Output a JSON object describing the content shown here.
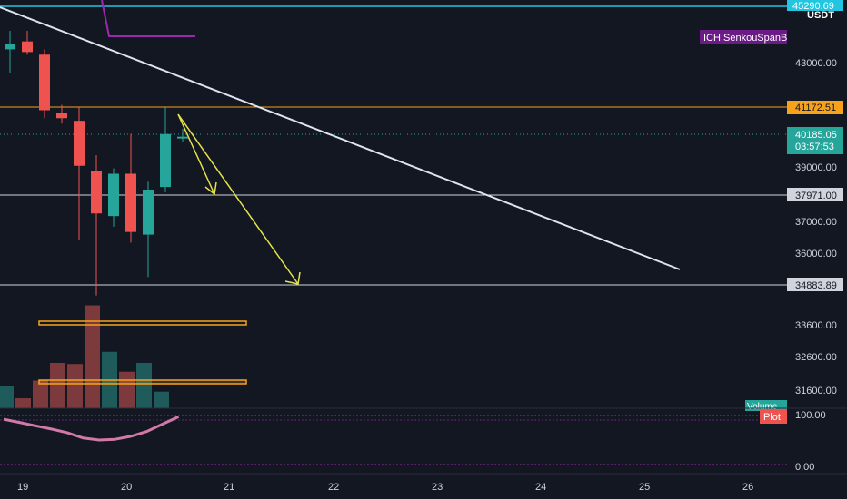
{
  "instrument": {
    "currency": "USDT",
    "top_price_partial": "45290.69"
  },
  "colors": {
    "background": "#131722",
    "up": "#26a69a",
    "down": "#ef5350",
    "volume_up": "#1f5b5a",
    "volume_down": "#7d3a3c",
    "trendline": "#e0e3eb",
    "arrows": "#e6e34a",
    "orange_level": "#f7a21b",
    "cyan_level": "#22c6e0",
    "purple": "#9c27b0",
    "oscillator": "#d27aa7",
    "grid_text": "#d1d4dc"
  },
  "indicators": {
    "senkou_label": "ICH:SenkouSpanB",
    "volume_label": "Volume",
    "plot_label": "Plot"
  },
  "chart_data": {
    "type": "candlestick",
    "x_axis": {
      "ticks": [
        "19",
        "20",
        "21",
        "22",
        "23",
        "24",
        "25",
        "26"
      ]
    },
    "y_axis": {
      "price_ticks": [
        "43000.00",
        "39000.00",
        "37000.00",
        "36000.00",
        "33600.00",
        "32600.00",
        "31600.00"
      ],
      "oscillator_ticks": [
        "100.00",
        "0.00"
      ]
    },
    "price_labels": {
      "last_price": "40185.05",
      "countdown": "03:57:53",
      "resistance": "41172.51",
      "support_1": "37971.00",
      "support_2": "34883.89"
    },
    "candles": [
      {
        "o": 43500,
        "h": 44200,
        "l": 42600,
        "c": 43700
      },
      {
        "o": 43800,
        "h": 44200,
        "l": 43300,
        "c": 43400
      },
      {
        "o": 43300,
        "h": 43500,
        "l": 40900,
        "c": 41200
      },
      {
        "o": 41100,
        "h": 41400,
        "l": 40700,
        "c": 40900
      },
      {
        "o": 40800,
        "h": 41300,
        "l": 36300,
        "c": 39100
      },
      {
        "o": 38900,
        "h": 39500,
        "l": 34200,
        "c": 37300
      },
      {
        "o": 37200,
        "h": 39000,
        "l": 36800,
        "c": 38800
      },
      {
        "o": 38800,
        "h": 40300,
        "l": 36200,
        "c": 36600
      },
      {
        "o": 36500,
        "h": 38500,
        "l": 34900,
        "c": 38200
      },
      {
        "o": 38300,
        "h": 41300,
        "l": 38100,
        "c": 40300
      },
      {
        "o": 40200,
        "h": 40500,
        "l": 40000,
        "c": 40200
      }
    ],
    "volumes": [
      {
        "v": 2,
        "up": true
      },
      {
        "v": 0.9,
        "up": false
      },
      {
        "v": 2.5,
        "up": false
      },
      {
        "v": 4.1,
        "up": false
      },
      {
        "v": 4.0,
        "up": false
      },
      {
        "v": 9.3,
        "up": false
      },
      {
        "v": 5.1,
        "up": true
      },
      {
        "v": 3.3,
        "up": false
      },
      {
        "v": 4.1,
        "up": true
      },
      {
        "v": 1.5,
        "up": true
      }
    ],
    "oscillator": [
      85,
      72,
      58,
      45,
      30,
      8,
      0,
      3,
      15,
      35,
      65,
      95
    ]
  }
}
